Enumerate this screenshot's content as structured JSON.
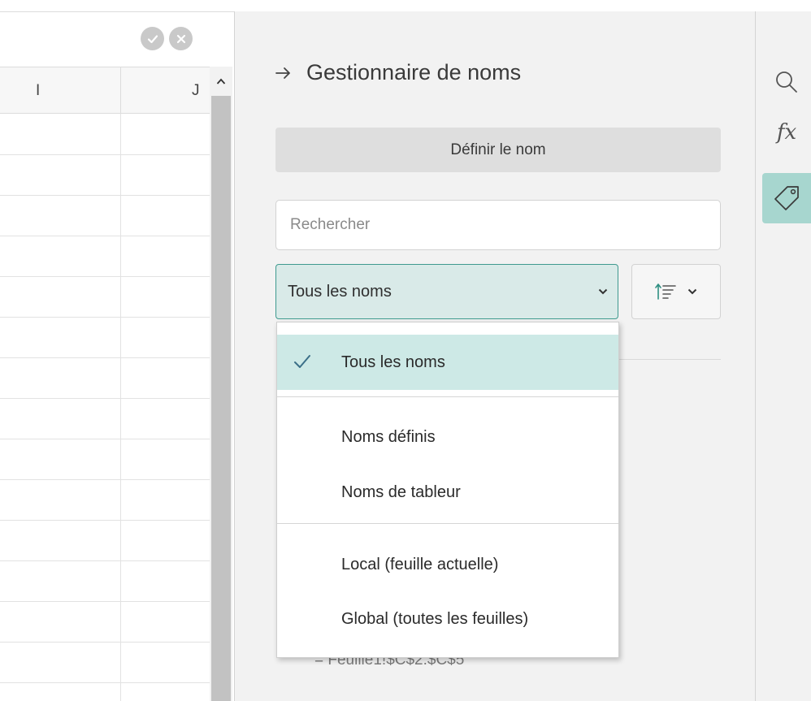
{
  "sheet": {
    "columns": [
      {
        "label": "I"
      },
      {
        "label": "J"
      }
    ]
  },
  "panel": {
    "title": "Gestionnaire de noms",
    "define_button": "Définir le nom",
    "search_placeholder": "Rechercher",
    "filter_value": "Tous les noms",
    "hidden_ref": "= Feuille1!$C$2:$C$5"
  },
  "dropdown": {
    "items": [
      {
        "label": "Tous les noms",
        "selected": true
      },
      {
        "label": "Noms définis",
        "selected": false
      },
      {
        "label": "Noms de tableur",
        "selected": false
      },
      {
        "label": "Local (feuille actuelle)",
        "selected": false
      },
      {
        "label": "Global (toutes les feuilles)",
        "selected": false
      }
    ]
  },
  "toolbar": {
    "buttons": [
      {
        "icon": "search-icon"
      },
      {
        "icon": "function-icon",
        "label": "fx"
      },
      {
        "icon": "tag-icon",
        "active": true
      }
    ]
  },
  "colors": {
    "accent": "#3f9a8f",
    "selected_bg": "#cde9e6",
    "active_tool_bg": "#a7d6cf",
    "panel_bg": "#f2f2f2"
  }
}
